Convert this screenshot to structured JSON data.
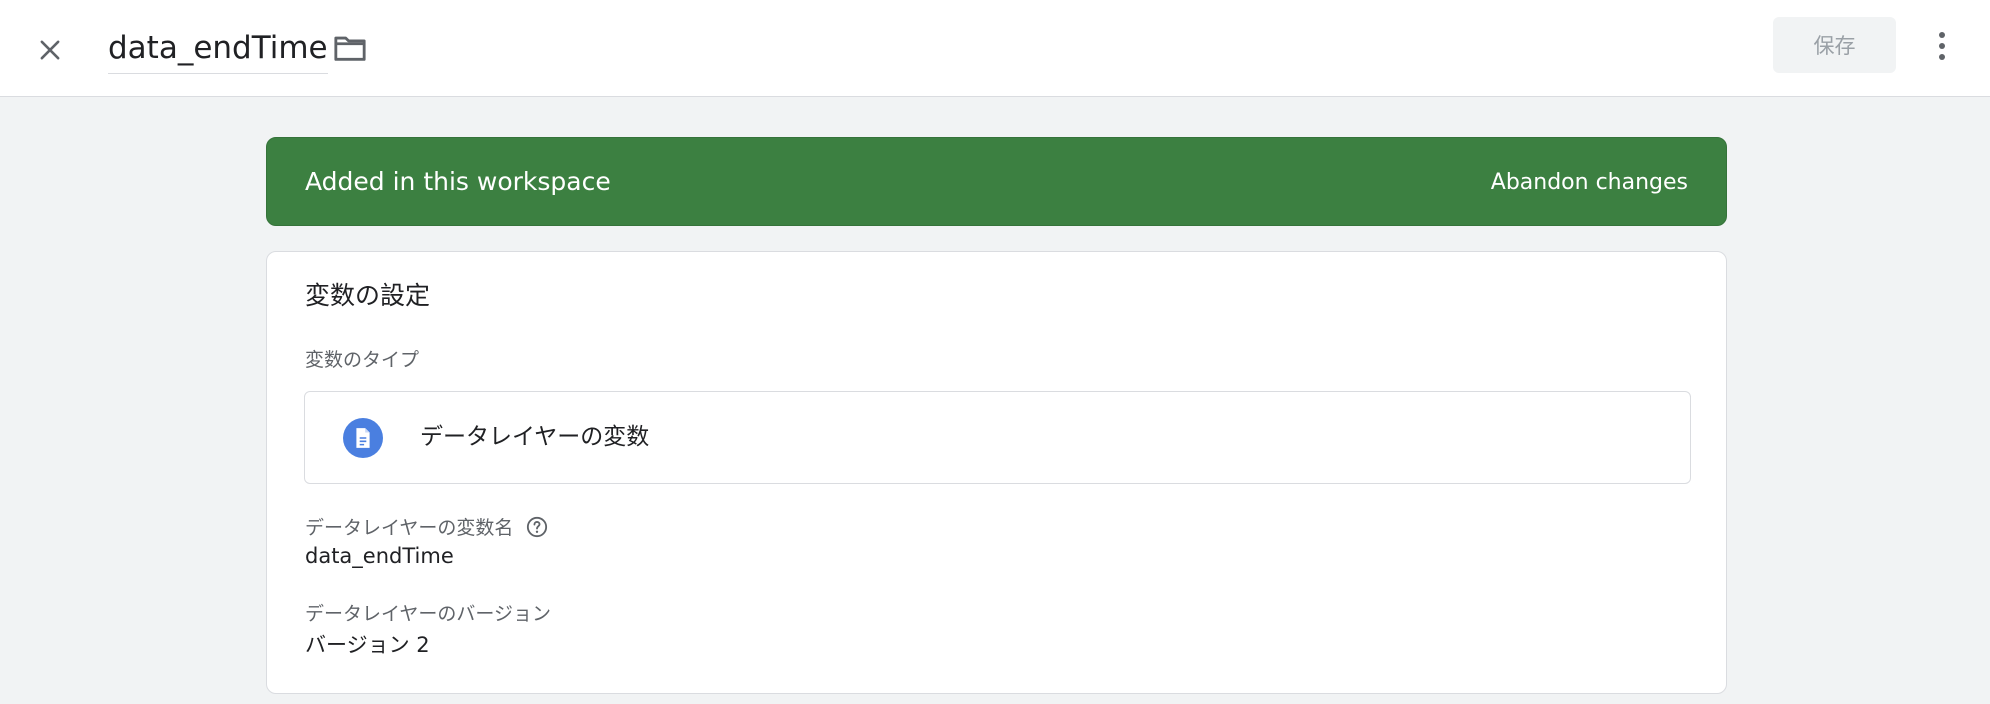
{
  "header": {
    "title": "data_endTime",
    "save_label": "保存"
  },
  "banner": {
    "message": "Added in this workspace",
    "action": "Abandon changes"
  },
  "config": {
    "heading": "変数の設定",
    "type_label": "変数のタイプ",
    "type_value": "データレイヤーの変数",
    "fields": [
      {
        "label": "データレイヤーの変数名",
        "value": "data_endTime",
        "has_help": true
      },
      {
        "label": "データレイヤーのバージョン",
        "value": "バージョン 2",
        "has_help": false
      }
    ]
  },
  "icons": {
    "close": "close-icon",
    "folder": "folder-icon",
    "more": "more-vert-icon",
    "type": "document-icon",
    "help": "help-circle-icon"
  },
  "colors": {
    "banner_green": "#3c8041",
    "icon_blue": "#4a7fe0",
    "background": "#f1f3f4"
  }
}
